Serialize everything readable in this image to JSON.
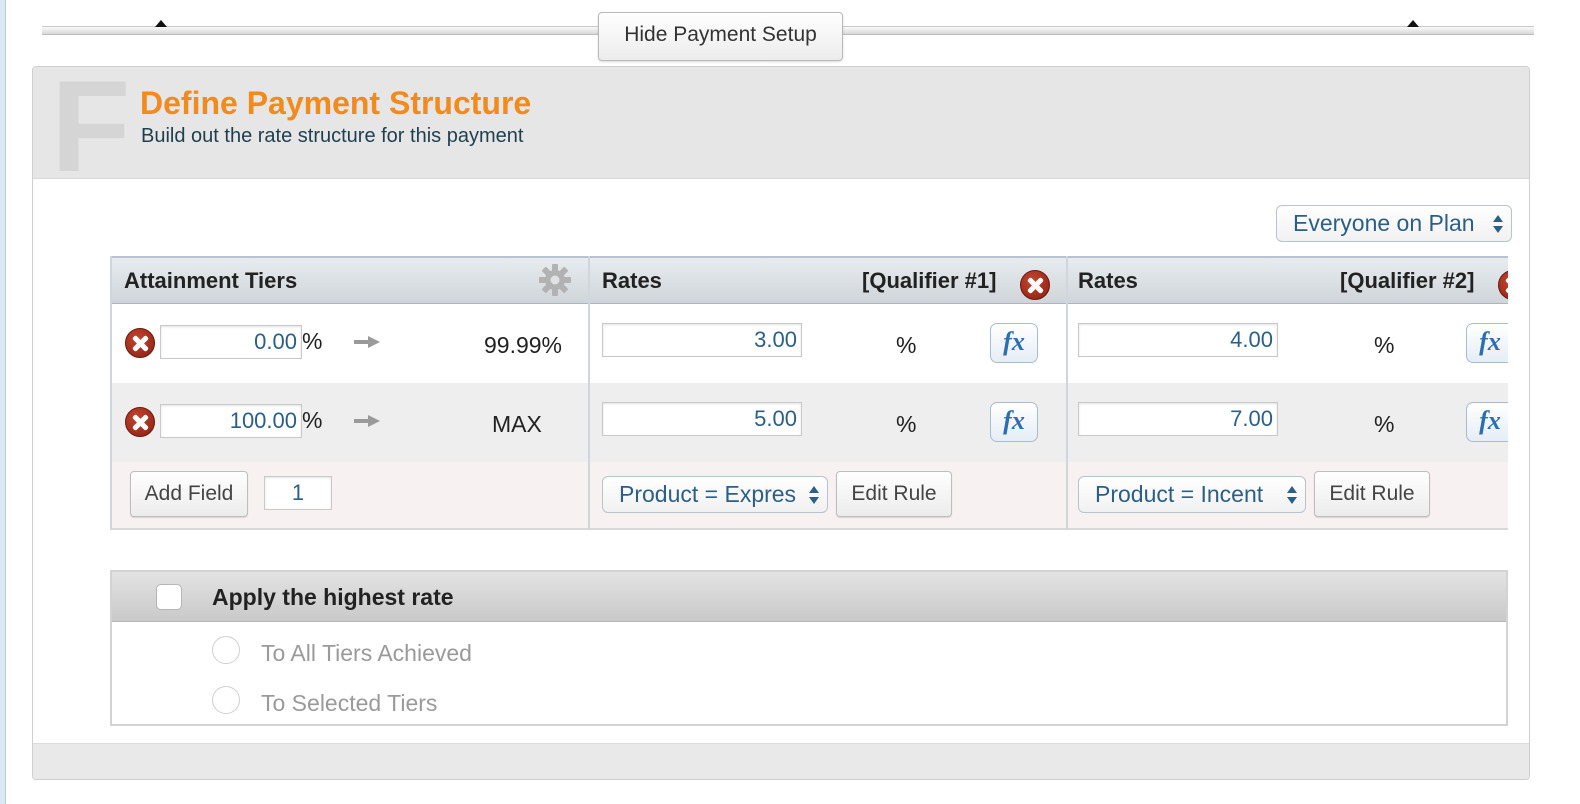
{
  "top_bar": {
    "hide_button_label": "Hide Payment Setup"
  },
  "section": {
    "letter": "F",
    "title": "Define Payment Structure",
    "subtitle": "Build out the rate structure for this payment",
    "audience_select": "Everyone on Plan"
  },
  "tiers": {
    "header": "Attainment Tiers",
    "rows": [
      {
        "from": "0.00",
        "from_unit": "%",
        "to": "99.99%"
      },
      {
        "from": "100.00",
        "from_unit": "%",
        "to": "MAX"
      }
    ],
    "add_field_label": "Add Field",
    "add_field_count": "1"
  },
  "qualifiers": [
    {
      "rates_header": "Rates",
      "label": "[Qualifier #1]",
      "rates": [
        "3.00",
        "5.00"
      ],
      "unit": "%",
      "fx_label": "fx",
      "rule_select": "Product = Expres",
      "edit_rule_label": "Edit Rule"
    },
    {
      "rates_header": "Rates",
      "label": "[Qualifier #2]",
      "rates": [
        "4.00",
        "7.00"
      ],
      "unit": "%",
      "fx_label": "fx",
      "rule_select": "Product = Incent",
      "edit_rule_label": "Edit Rule"
    }
  ],
  "apply_highest": {
    "label": "Apply the highest rate",
    "checked": false,
    "options": [
      "To All Tiers Achieved",
      "To Selected Tiers"
    ]
  },
  "colors": {
    "title_orange": "#f28a1c",
    "link_blue": "#2b5f86",
    "delete_red": "#a8301f"
  }
}
